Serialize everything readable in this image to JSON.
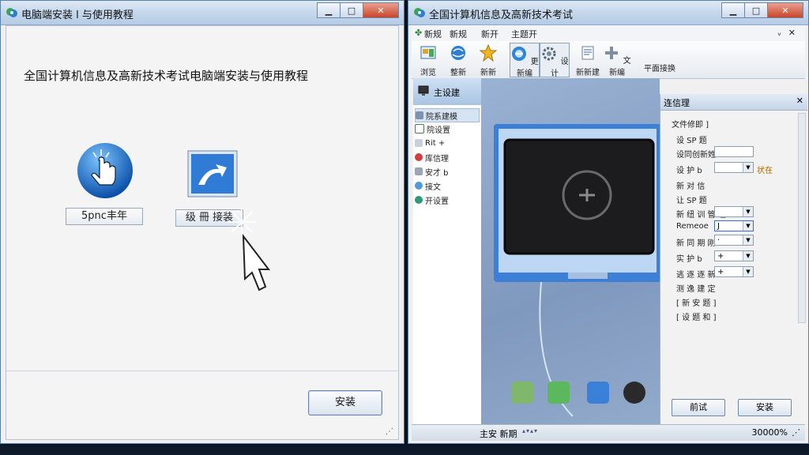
{
  "left_window": {
    "title": "电脑端安装 l 与使用教程",
    "heading": "全国计算机信息及高新技术考试电脑端安装与使用教程",
    "option1_label": "5pnc丰年",
    "option2_label": "级 冊 接装",
    "install_button": "安装"
  },
  "right_window": {
    "title": "全国计算机信息及高新技术考试",
    "menu": [
      "新规",
      "新规",
      "新开",
      "主题开"
    ],
    "toolbar": [
      "浏览",
      "整新",
      "新新",
      "更新编",
      "设计",
      "新新建",
      "文新编",
      "平面接换"
    ],
    "sidebar": {
      "header": "主设建",
      "items": [
        "院系建模",
        "院设置",
        "Rit +",
        "库信理",
        "安才 b",
        "接文",
        "开设置"
      ]
    },
    "props_panel": {
      "title": "连信理",
      "section_title": "文件修即 ]",
      "rows": [
        "设 SP 题",
        "设同创新姓",
        "设 护 b",
        "新 对 信",
        "让 SP 题",
        "新 纽 训 管 理",
        "Remeoe",
        "新 同 期 刚 ·",
        "实 护 b",
        "逃 逐 逐 新",
        "测 逸 建 定",
        "[ 新 安 题 ]",
        "[ 设 题 和 ]"
      ],
      "side_value": "状在",
      "remeoe_value": "J",
      "dd_values": [
        "·",
        "+",
        "+",
        "+"
      ],
      "button_left": "前试",
      "button_right": "安装"
    },
    "status_left": "主安 新期",
    "status_right": "30000%",
    "status_arrows": "▴▾▴▾"
  },
  "colors": {
    "titlebar": "#c5d7ec",
    "close": "#c9452b",
    "canvas": "#8aa2c5"
  }
}
